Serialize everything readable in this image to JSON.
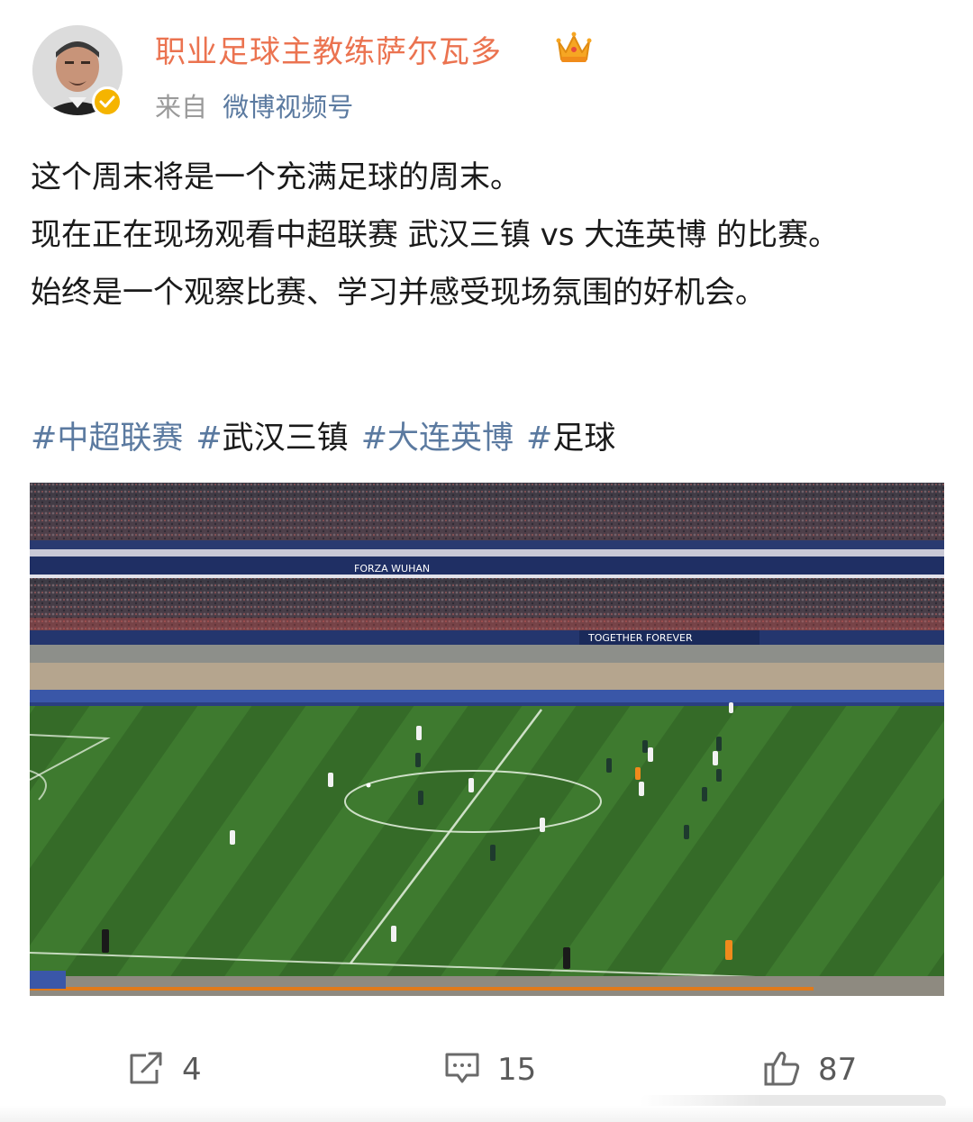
{
  "author": {
    "name": "职业足球主教练萨尔瓦多",
    "source_prefix": "来自",
    "source_link": "微博视频号",
    "badge_icon": "crown-icon",
    "verified_icon": "verified-badge-icon",
    "name_color": "#eb7350"
  },
  "post": {
    "paragraphs": [
      "这个周末将是一个充满足球的周末。",
      "现在正在现场观看中超联赛 武汉三镇 vs 大连英博 的比赛。",
      "始终是一个观察比赛、学习并感受现场氛围的好机会。"
    ],
    "hashtags": [
      {
        "hash": "#",
        "text": "中超联赛",
        "style": "link"
      },
      {
        "hash": "#",
        "text": "武汉三镇",
        "style": "plain"
      },
      {
        "hash": "#",
        "text": "大连英博",
        "style": "link"
      },
      {
        "hash": "#",
        "text": "足球",
        "style": "plain"
      }
    ],
    "link_color": "#5b7aa0"
  },
  "photo": {
    "banners": {
      "upper_left": "FORZA WUHAN",
      "lower_mid": "TOGETHER FOREVER"
    }
  },
  "actions": {
    "share": {
      "icon": "share-icon",
      "count": "4"
    },
    "comment": {
      "icon": "comment-icon",
      "count": "15"
    },
    "like": {
      "icon": "thumbs-up-icon",
      "count": "87"
    }
  }
}
